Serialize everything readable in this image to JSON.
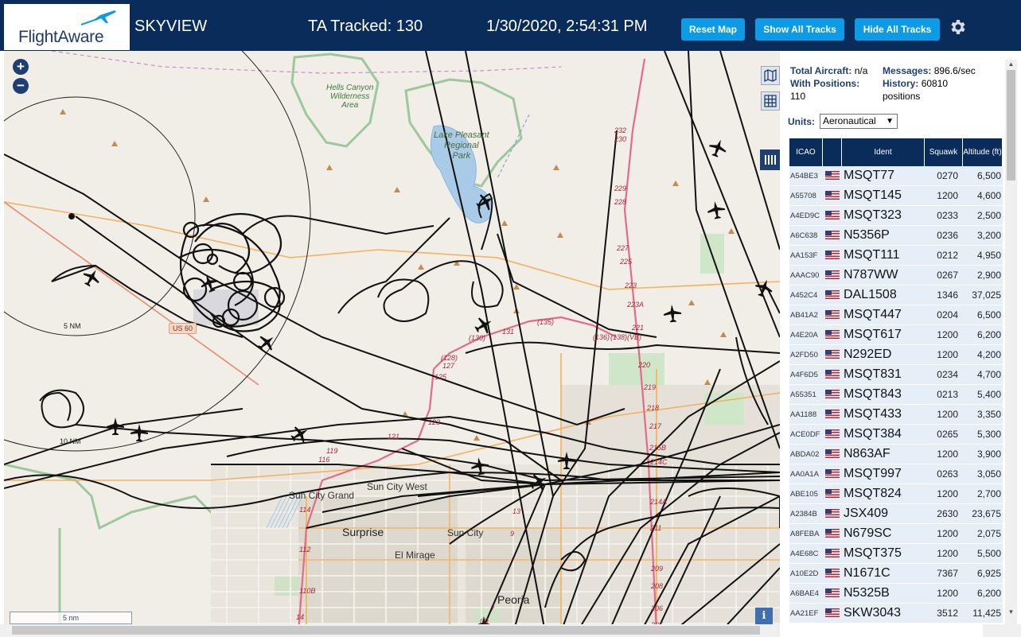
{
  "header": {
    "logo_text": "FlightAware",
    "app_title": "SKYVIEW",
    "tracked": "TA Tracked: 130",
    "datetime": "1/30/2020, 2:54:31 PM",
    "buttons": {
      "reset_map": "Reset Map",
      "show_all_tracks": "Show All Tracks",
      "hide_all_tracks": "Hide All Tracks"
    },
    "settings_icon": "gear-icon"
  },
  "map": {
    "zoom_in": "+",
    "zoom_out": "−",
    "scale": "5 nm",
    "info": "i",
    "labels": {
      "hells_canyon": "Hells Canyon\nWilderness\nArea",
      "lake_pleasant": "Lake Pleasant\nRegional\nPark",
      "us60": "US 60",
      "ring_5nm": "5 NM",
      "ring_10nm": "10 NM",
      "sun_city_west": "Sun City West",
      "sun_city_grand": "Sun City Grand",
      "surprise": "Surprise",
      "sun_city": "Sun City",
      "el_mirage": "El Mirage",
      "peoria": "Peoria"
    },
    "road_numbers": [
      "232",
      "230",
      "229",
      "228",
      "227",
      "225",
      "223",
      "223A",
      "221",
      "220",
      "219",
      "218",
      "217",
      "215B",
      "214C",
      "214A",
      "211",
      "209",
      "208",
      "206",
      "205",
      "(135)",
      "(130)",
      "131",
      "(136)",
      "(138)(VB)",
      "(128)",
      "127",
      "125",
      "123",
      "121",
      "119",
      "116",
      "114",
      "112",
      "110B",
      "14",
      "13",
      "9",
      "7",
      "(3)",
      "2"
    ],
    "controls": {
      "layers_icon": "map-layers-icon",
      "grid_icon": "grid-icon",
      "columns_icon": "columns-icon"
    }
  },
  "panel": {
    "total_aircraft_label": "Total Aircraft:",
    "total_aircraft_value": "n/a",
    "with_positions_label": "With Positions:",
    "with_positions_value": "110",
    "messages_label": "Messages:",
    "messages_value": "896.6/sec",
    "history_label": "History:",
    "history_value": "60810",
    "history_unit": "positions",
    "units_label": "Units:",
    "units_value": "Aeronautical",
    "columns": [
      "ICAO",
      "",
      "Ident",
      "Squawk",
      "Altitude (ft)"
    ],
    "rows": [
      {
        "icao": "A54BE3",
        "ident": "MSQT77",
        "squawk": "0270",
        "alt": "6,500"
      },
      {
        "icao": "A55708",
        "ident": "MSQT145",
        "squawk": "1200",
        "alt": "4,600"
      },
      {
        "icao": "A4ED9C",
        "ident": "MSQT323",
        "squawk": "0233",
        "alt": "2,500"
      },
      {
        "icao": "A6C638",
        "ident": "N5356P",
        "squawk": "0236",
        "alt": "3,200"
      },
      {
        "icao": "AA153F",
        "ident": "MSQT111",
        "squawk": "0212",
        "alt": "4,950"
      },
      {
        "icao": "AAAC90",
        "ident": "N787WW",
        "squawk": "0267",
        "alt": "2,900"
      },
      {
        "icao": "A452C4",
        "ident": "DAL1508",
        "squawk": "1346",
        "alt": "37,025"
      },
      {
        "icao": "AB41A2",
        "ident": "MSQT447",
        "squawk": "0204",
        "alt": "6,500"
      },
      {
        "icao": "A4E20A",
        "ident": "MSQT617",
        "squawk": "1200",
        "alt": "6,200"
      },
      {
        "icao": "A2FD50",
        "ident": "N292ED",
        "squawk": "1200",
        "alt": "4,200"
      },
      {
        "icao": "A4F6D5",
        "ident": "MSQT831",
        "squawk": "0234",
        "alt": "4,700"
      },
      {
        "icao": "A55351",
        "ident": "MSQT843",
        "squawk": "0213",
        "alt": "5,400"
      },
      {
        "icao": "AA1188",
        "ident": "MSQT433",
        "squawk": "1200",
        "alt": "3,350"
      },
      {
        "icao": "ACE0DF",
        "ident": "MSQT384",
        "squawk": "0265",
        "alt": "5,300"
      },
      {
        "icao": "ABDA02",
        "ident": "N863AF",
        "squawk": "1200",
        "alt": "3,900"
      },
      {
        "icao": "AA0A1A",
        "ident": "MSQT997",
        "squawk": "0263",
        "alt": "3,050"
      },
      {
        "icao": "ABE105",
        "ident": "MSQT824",
        "squawk": "1200",
        "alt": "2,700"
      },
      {
        "icao": "A2384B",
        "ident": "JSX409",
        "squawk": "2630",
        "alt": "23,675"
      },
      {
        "icao": "A8FEBA",
        "ident": "N679SC",
        "squawk": "1200",
        "alt": "2,075"
      },
      {
        "icao": "A4E68C",
        "ident": "MSQT375",
        "squawk": "1200",
        "alt": "5,500"
      },
      {
        "icao": "A10E2D",
        "ident": "N1671C",
        "squawk": "7367",
        "alt": "6,925"
      },
      {
        "icao": "A6BAE4",
        "ident": "N5325B",
        "squawk": "1200",
        "alt": "6,200"
      },
      {
        "icao": "AA21EF",
        "ident": "SKW3043",
        "squawk": "3512",
        "alt": "11,425"
      }
    ]
  },
  "colors": {
    "header_bg": "#0a2c5a",
    "button_bg": "#0e9be5",
    "row_bg": "#e6eef8",
    "track": "#111111"
  }
}
